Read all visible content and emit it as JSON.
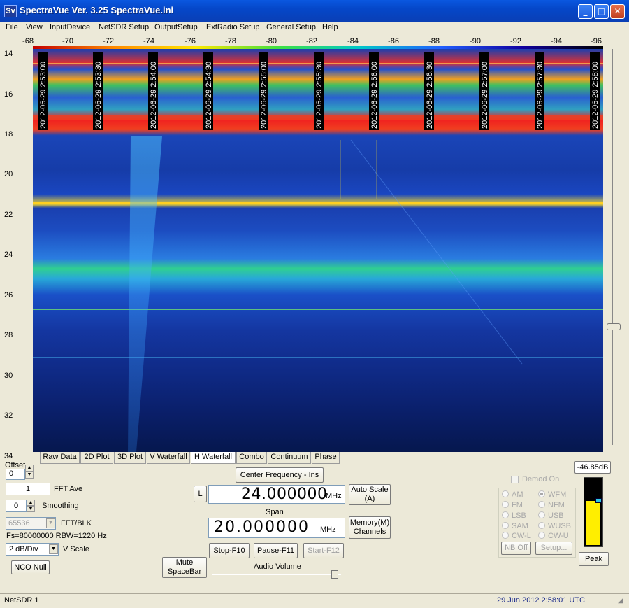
{
  "window": {
    "icon_text": "Sv",
    "title": "SpectraVue Ver. 3.25  SpectraVue.ini",
    "minimize": "_",
    "maximize": "□",
    "close": "✕"
  },
  "menu": [
    "File",
    "View",
    "InputDevice",
    "NetSDR Setup",
    "OutputSetup",
    "ExtRadio Setup",
    "General Setup",
    "Help"
  ],
  "x_axis_ticks": [
    "-68",
    "-70",
    "-72",
    "-74",
    "-76",
    "-78",
    "-80",
    "-82",
    "-84",
    "-86",
    "-88",
    "-90",
    "-92",
    "-94",
    "-96"
  ],
  "y_axis_ticks": [
    "14",
    "16",
    "18",
    "20",
    "22",
    "24",
    "26",
    "28",
    "30",
    "32",
    "34"
  ],
  "timestamps": [
    "2012-06-29 2:53:00",
    "2012-06-29 2:53:30",
    "2012-06-29 2:54:00",
    "2012-06-29 2:54:30",
    "2012-06-29 2:55:00",
    "2012-06-29 2:55:30",
    "2012-06-29 2:56:00",
    "2012-06-29 2:56:30",
    "2012-06-29 2:57:00",
    "2012-06-29 2:57:30",
    "2012-06-29 2:58:00"
  ],
  "tabs": [
    "Raw Data",
    "2D Plot",
    "3D Plot",
    "V Waterfall",
    "H Waterfall",
    "Combo",
    "Continuum",
    "Phase"
  ],
  "active_tab": "H Waterfall",
  "controls": {
    "offset_label": "Offset",
    "offset_value": "0",
    "fft_ave_value": "1",
    "fft_ave_label": "FFT Ave",
    "smoothing_value": "0",
    "smoothing_label": "Smoothing",
    "fft_blk_value": "65536",
    "fft_blk_label": "FFT/BLK",
    "fs_rbw": "Fs=80000000 RBW=1220 Hz",
    "vscale_value": "2 dB/Div",
    "vscale_label": "V Scale",
    "nco_null": "NCO Null",
    "mute": "Mute\nSpaceBar",
    "center_freq_btn": "Center Frequency - Ins",
    "l_btn": "L",
    "center_freq": "24.000000",
    "freq_unit": "MHz",
    "span_label": "Span",
    "span": "20.000000",
    "span_unit": "MHz",
    "auto_scale": "Auto Scale\n(A)",
    "memory": "Memory(M)\nChannels",
    "stop": "Stop-F10",
    "pause": "Pause-F11",
    "start": "Start-F12",
    "audio_volume": "Audio Volume"
  },
  "demod": {
    "checkbox_label": "Demod On",
    "modes_left": [
      "AM",
      "FM",
      "LSB",
      "SAM",
      "CW-L"
    ],
    "modes_right": [
      "WFM",
      "NFM",
      "USB",
      "WUSB",
      "CW-U"
    ],
    "selected": "WFM",
    "nb_off": "NB Off",
    "setup": "Setup..."
  },
  "meter": {
    "reading": "-46.85dB",
    "peak": "Peak",
    "level": 0.67
  },
  "status": {
    "device": "NetSDR 1",
    "timestamp": "29 Jun 2012  2:58:01 UTC"
  },
  "colors": {
    "title_blue": "#0547c9",
    "waterfall_bg": "#06216a",
    "status_time": "#1a2a8a"
  }
}
